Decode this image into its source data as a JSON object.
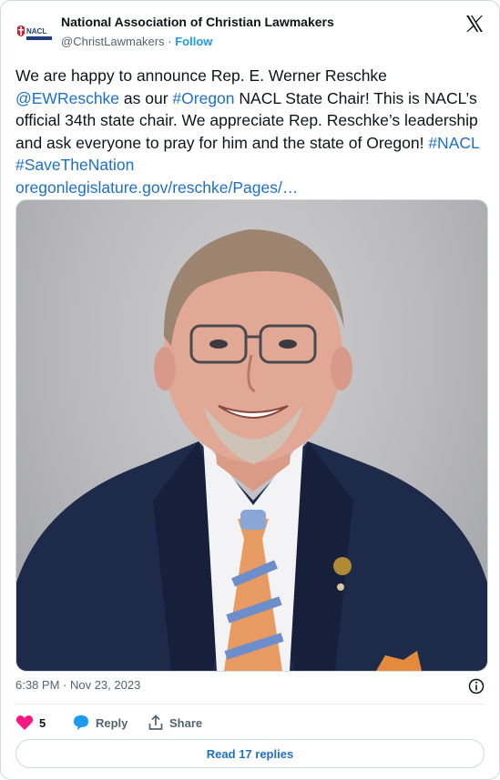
{
  "header": {
    "display_name": "National Association of Christian Lawmakers",
    "handle": "@ChristLawmakers",
    "separator": "·",
    "follow_label": "Follow",
    "logo_text": "NACL"
  },
  "tweet": {
    "text_1": "We are happy to announce Rep. E. Werner Reschke ",
    "mention": "@EWReschke",
    "text_2": " as our ",
    "hashtag_oregon": "#Oregon",
    "text_3": " NACL State Chair! This is NACL’s official 34th state chair. We appreciate Rep. Reschke’s leadership and ask everyone to pray for him and the state of Oregon! ",
    "hashtag_nacl": "#NACL",
    "text_4": " ",
    "hashtag_save": "#SaveTheNation",
    "link": "oregonlegislature.gov/reschke/Pages/…"
  },
  "meta": {
    "timestamp": "6:38 PM · Nov 23, 2023"
  },
  "actions": {
    "like_count": "5",
    "reply_label": "Reply",
    "share_label": "Share"
  },
  "read_replies_label": "Read 17 replies",
  "colors": {
    "link": "#1d6fc9",
    "like": "#f91880",
    "follow": "#1d9bf0",
    "muted": "#536471"
  }
}
